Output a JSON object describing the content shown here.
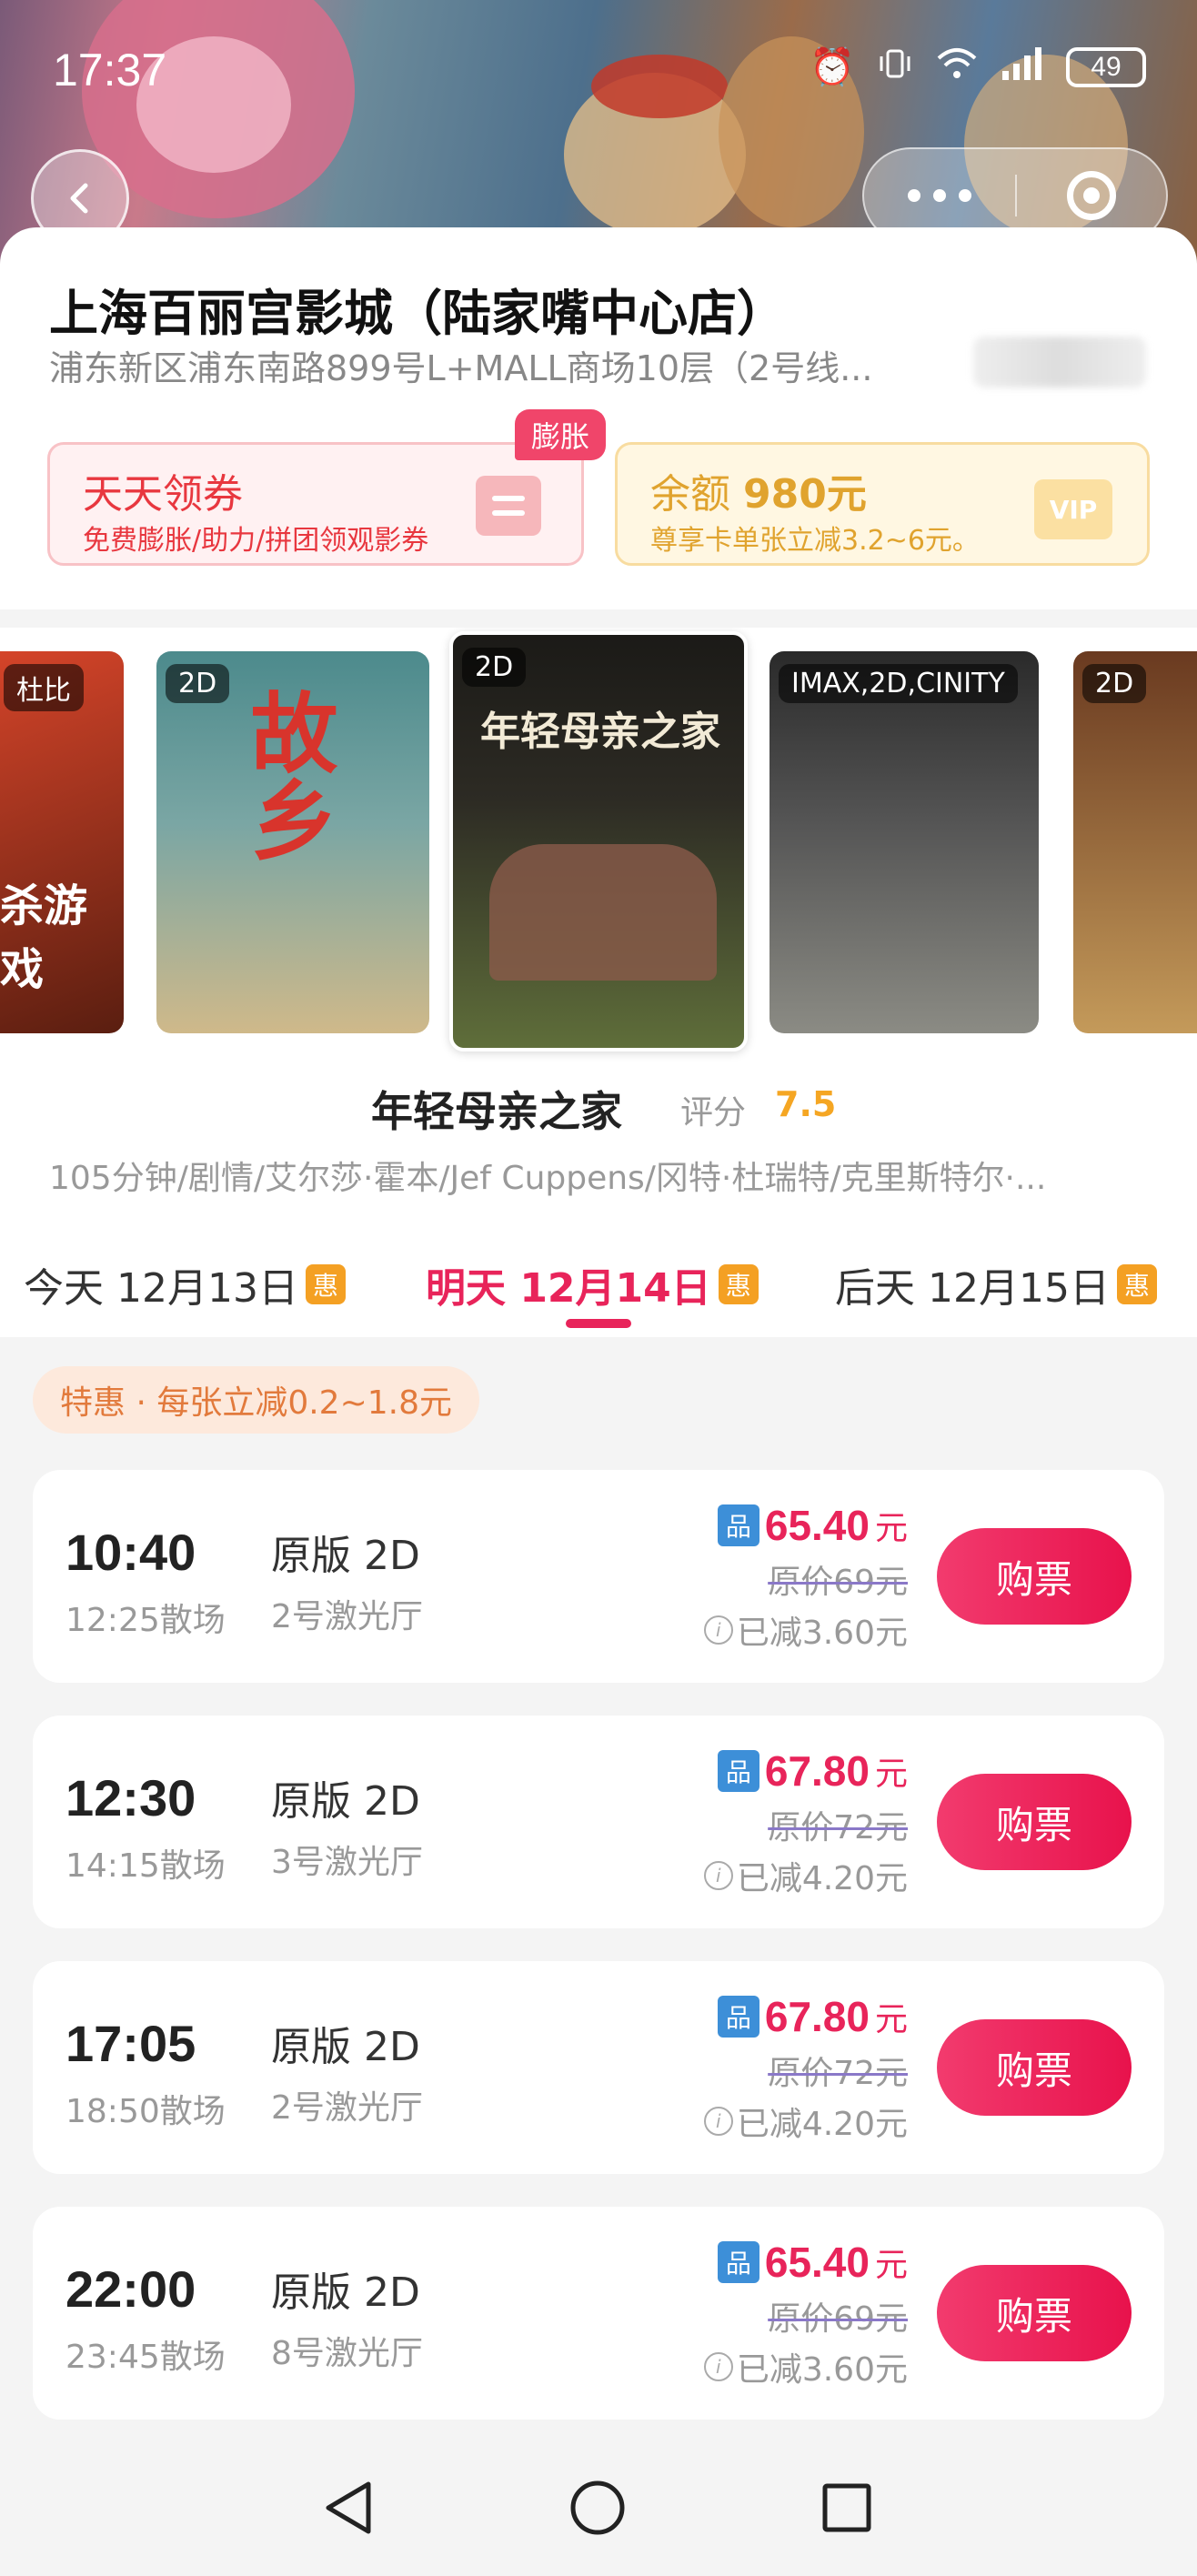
{
  "status_bar": {
    "time": "17:37",
    "battery": "49",
    "icons": [
      "alarm-icon",
      "vibrate-icon",
      "wifi-icon",
      "signal-icon",
      "battery-icon"
    ]
  },
  "cinema": {
    "name": "上海百丽宫影城（陆家嘴中心店）",
    "address": "浦东新区浦东南路899号L+MALL商场10层（2号线..."
  },
  "promos": {
    "coupon": {
      "title": "天天领券",
      "subtitle": "免费膨胀/助力/拼团领观影券",
      "badge": "膨胀"
    },
    "vip": {
      "title_prefix": "余额",
      "amount": "980元",
      "subtitle": "尊享卡单张立减3.2~6元。",
      "icon_text": "VIP"
    }
  },
  "posters": [
    {
      "format": "杜比",
      "art_text": "杀游戏",
      "colors": [
        "#d8452a",
        "#5a1e10"
      ]
    },
    {
      "format": "2D",
      "art_text": "故乡",
      "colors": [
        "#4c8a8c",
        "#cfb98a"
      ]
    },
    {
      "format": "2D",
      "art_text": "年轻母亲之家",
      "colors": [
        "#1b1a17",
        "#5f6e3a"
      ]
    },
    {
      "format": "IMAX,2D,CINITY",
      "art_text": "",
      "colors": [
        "#2a2a2a",
        "#8b8b84"
      ]
    },
    {
      "format": "2D",
      "art_text": "",
      "colors": [
        "#6a3a20",
        "#c49a5a"
      ]
    }
  ],
  "movie": {
    "title": "年轻母亲之家",
    "rating_label": "评分",
    "rating": "7.5",
    "meta": "105分钟/剧情/艾尔莎·霍本/Jef Cuppens/冈特·杜瑞特/克里斯特尔·..."
  },
  "date_tabs": [
    {
      "label": "今天 12月13日",
      "badge": "惠",
      "active": false
    },
    {
      "label": "明天 12月14日",
      "badge": "惠",
      "active": true
    },
    {
      "label": "后天 12月15日",
      "badge": "惠",
      "active": false
    }
  ],
  "discount_note": "特惠 · 每张立减0.2~1.8元",
  "showtimes": [
    {
      "start": "10:40",
      "end": "12:25散场",
      "version": "原版 2D",
      "hall": "2号激光厅",
      "badge": "品",
      "price": "65.40",
      "unit": "元",
      "original": "原价69元",
      "saved": "已减3.60元",
      "buy": "购票"
    },
    {
      "start": "12:30",
      "end": "14:15散场",
      "version": "原版 2D",
      "hall": "3号激光厅",
      "badge": "品",
      "price": "67.80",
      "unit": "元",
      "original": "原价72元",
      "saved": "已减4.20元",
      "buy": "购票"
    },
    {
      "start": "17:05",
      "end": "18:50散场",
      "version": "原版 2D",
      "hall": "2号激光厅",
      "badge": "品",
      "price": "67.80",
      "unit": "元",
      "original": "原价72元",
      "saved": "已减4.20元",
      "buy": "购票"
    },
    {
      "start": "22:00",
      "end": "23:45散场",
      "version": "原版 2D",
      "hall": "8号激光厅",
      "badge": "品",
      "price": "65.40",
      "unit": "元",
      "original": "原价69元",
      "saved": "已减3.60元",
      "buy": "购票"
    }
  ],
  "nav": {
    "icons": [
      "back-triangle-icon",
      "home-circle-icon",
      "recents-square-icon"
    ]
  },
  "colors": {
    "accent": "#e8245a",
    "rating": "#f5a623",
    "vip_gold": "#e0a32e",
    "discount_text": "#e27a3c",
    "badge_blue": "#3d8fd8"
  }
}
